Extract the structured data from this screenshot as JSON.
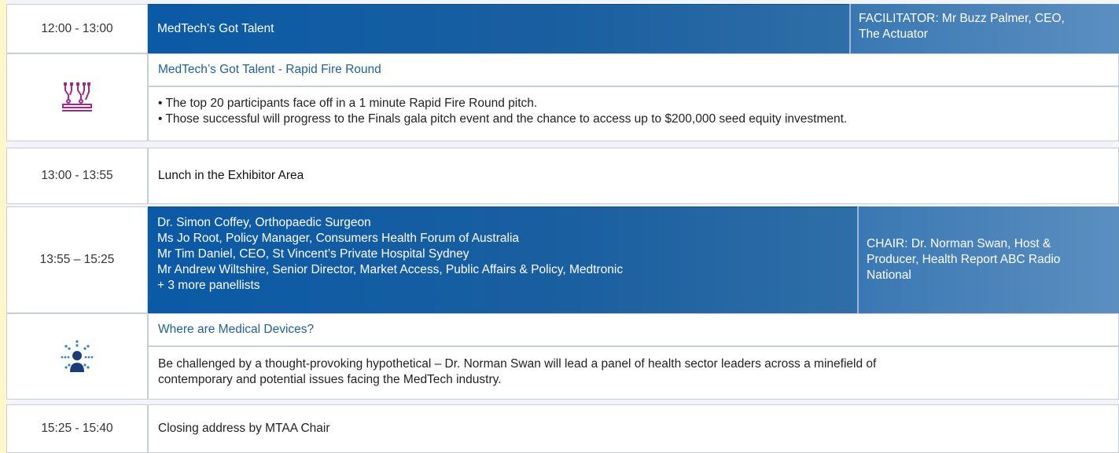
{
  "colors": {
    "accent_blue": "#0b5aa6",
    "side_blue": "#4a84ba",
    "link_blue": "#1d5fa3",
    "icon_magenta": "#a0288c",
    "icon_navy": "#1b3e7a",
    "icon_blue": "#2f7fd0"
  },
  "sessions": {
    "talent": {
      "time": "12:00 - 13:00",
      "title": "MedTech’s Got Talent",
      "facilitator_line1": "FACILITATOR: Mr Buzz Palmer, CEO,",
      "facilitator_line2": "The Actuator",
      "icon": "robotic-arms-icon",
      "subtitle": "MedTech’s Got Talent - Rapid Fire Round",
      "bullets": [
        "• The top 20 participants face off in a 1 minute Rapid Fire Round pitch.",
        "• Those successful will progress to the Finals gala pitch event and the chance to access up to $200,000 seed equity investment."
      ]
    },
    "lunch": {
      "time": "13:00 - 13:55",
      "title": "Lunch in the Exhibitor Area"
    },
    "panel": {
      "time": "13:55 – 15:25",
      "speakers": [
        "Dr. Simon Coffey, Orthopaedic Surgeon",
        "Ms Jo Root, Policy Manager, Consumers Health Forum of Australia",
        "Mr Tim Daniel, CEO, St Vincent’s Private Hospital Sydney",
        "Mr Andrew Wiltshire, Senior Director, Market Access, Public Affairs & Policy, Medtronic",
        "+ 3 more panellists"
      ],
      "chair_lines": [
        "CHAIR: Dr. Norman Swan, Host &",
        "Producer, Health Report ABC Radio",
        "National"
      ],
      "icon": "person-radiating-icon",
      "subtitle": "Where are Medical Devices?",
      "description_lines": [
        "Be challenged by a thought-provoking hypothetical – Dr. Norman Swan will lead a panel of health sector leaders across a minefield of",
        "contemporary and potential issues facing the MedTech industry."
      ]
    },
    "closing": {
      "time": "15:25 - 15:40",
      "title": "Closing address by MTAA Chair"
    }
  }
}
